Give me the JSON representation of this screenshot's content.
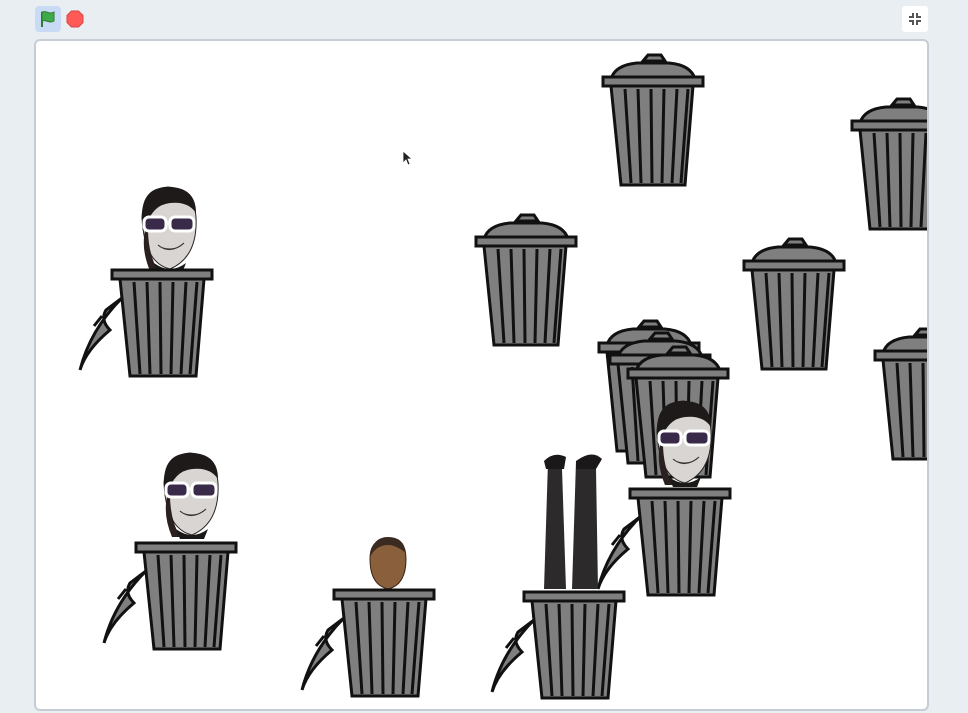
{
  "toolbar": {
    "icons": [
      "green-flag-icon",
      "stop-icon",
      "exit-fullscreen-icon"
    ],
    "flag_color": "#3eaa4a",
    "stop_color": "#ff5a58",
    "accent": "#c9dbf4"
  },
  "stage": {
    "background": "#ffffff",
    "border_color": "#c6cdd6",
    "sprites": {
      "trash_cans_closed": 9,
      "trash_cans_open": 5,
      "heads_with_sunglasses": 3,
      "plain_head": 1,
      "legs_upside_down": 1
    },
    "colors": {
      "can_fill": "#7f7f7f",
      "can_outline": "#111111",
      "sunglasses": "#ffffff"
    }
  }
}
